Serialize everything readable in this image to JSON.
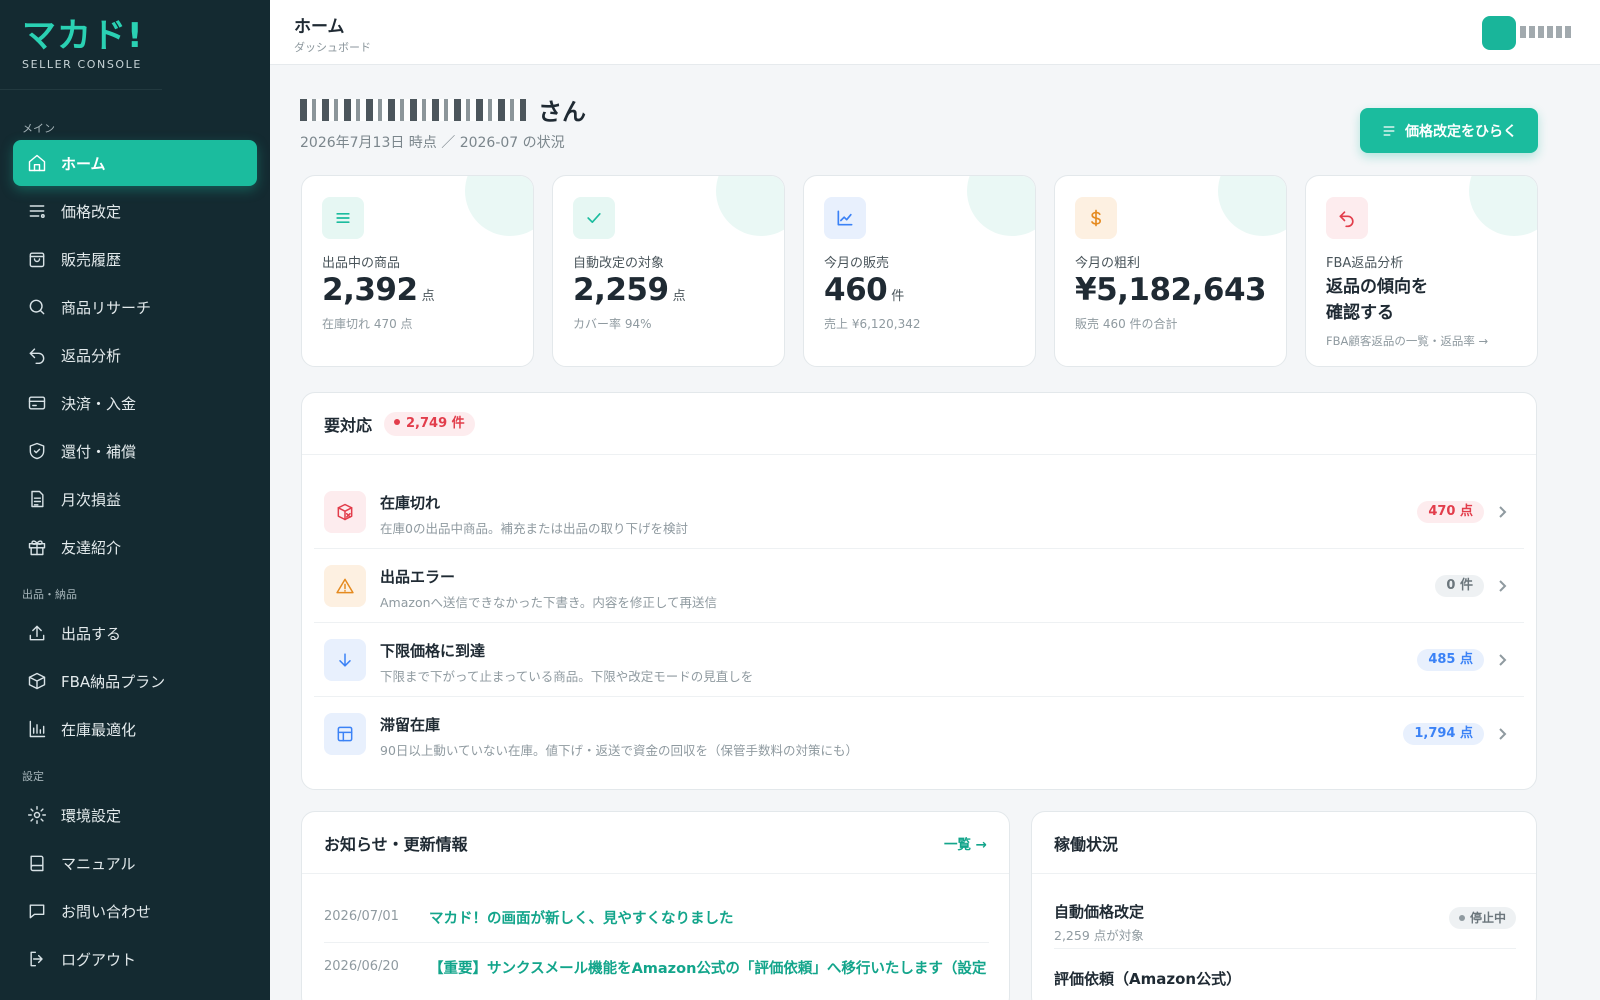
{
  "brand": {
    "logo": "マカド!",
    "sub": "SELLER CONSOLE"
  },
  "sidebar": {
    "sections": [
      {
        "label": "メイン"
      },
      {
        "label": "出品・納品"
      },
      {
        "label": "設定"
      }
    ],
    "items": [
      {
        "label": "ホーム",
        "icon": "home-icon"
      },
      {
        "label": "価格改定",
        "icon": "list-icon"
      },
      {
        "label": "販売履歴",
        "icon": "bag-icon"
      },
      {
        "label": "商品リサーチ",
        "icon": "search-icon"
      },
      {
        "label": "返品分析",
        "icon": "undo-icon"
      },
      {
        "label": "決済・入金",
        "icon": "credit-card-icon"
      },
      {
        "label": "還付・補償",
        "icon": "shield-check-icon"
      },
      {
        "label": "月次損益",
        "icon": "document-icon"
      },
      {
        "label": "友達紹介",
        "icon": "gift-icon"
      },
      {
        "label": "出品する",
        "icon": "upload-icon"
      },
      {
        "label": "FBA納品プラン",
        "icon": "box-icon"
      },
      {
        "label": "在庫最適化",
        "icon": "bar-chart-icon"
      },
      {
        "label": "環境設定",
        "icon": "gear-icon"
      },
      {
        "label": "マニュアル",
        "icon": "book-icon"
      },
      {
        "label": "お問い合わせ",
        "icon": "chat-icon"
      },
      {
        "label": "ログアウト",
        "icon": "logout-icon"
      }
    ]
  },
  "header": {
    "title": "ホーム",
    "subtitle": "ダッシュボード"
  },
  "greeting": {
    "suffix": "さん",
    "meta": "2026年7月13日 時点 ／ 2026-07 の状況"
  },
  "primary_button": {
    "label": "価格改定をひらく"
  },
  "stats": [
    {
      "label": "出品中の商品",
      "value": "2,392",
      "unit": "点",
      "sub": "在庫切れ 470 点",
      "icon": "list-icon",
      "color": "#1bbc9e",
      "bg": "#e6f7f3"
    },
    {
      "label": "自動改定の対象",
      "value": "2,259",
      "unit": "点",
      "sub": "カバー率 94%",
      "icon": "check-icon",
      "color": "#1bbc9e",
      "bg": "#e6f7f3"
    },
    {
      "label": "今月の販売",
      "value": "460",
      "unit": "件",
      "sub": "売上 ¥6,120,342",
      "icon": "line-chart-icon",
      "color": "#3b82f6",
      "bg": "#e8f0fd"
    },
    {
      "label": "今月の粗利",
      "value": "¥5,182,643",
      "unit": "",
      "sub": "販売 460 件の合計",
      "icon": "dollar-icon",
      "color": "#e58a1f",
      "bg": "#fdf0e1"
    },
    {
      "label": "FBA返品分析",
      "big1": "返品の傾向を",
      "big2": "確認する",
      "sub": "FBA顧客返品の一覧・返品率 →",
      "icon": "undo-icon",
      "color": "#e23d4b",
      "bg": "#fdecee"
    }
  ],
  "actions": {
    "title": "要対応",
    "count": "2,749 件",
    "rows": [
      {
        "title": "在庫切れ",
        "desc": "在庫0の出品中商品。補充または出品の取り下げを検討",
        "badge": "470 点",
        "icon": "box-alert-icon",
        "color": "#e23d4b",
        "bg": "#fdecee",
        "badge_color": "#e23d4b",
        "badge_bg": "#fdecee"
      },
      {
        "title": "出品エラー",
        "desc": "Amazonへ送信できなかった下書き。内容を修正して再送信",
        "badge": "0 件",
        "icon": "warning-icon",
        "color": "#e58a1f",
        "bg": "#fdf0e1",
        "badge_color": "#6b767c",
        "badge_bg": "#eef1f3"
      },
      {
        "title": "下限価格に到達",
        "desc": "下限まで下がって止まっている商品。下限や改定モードの見直しを",
        "badge": "485 点",
        "icon": "arrow-down-icon",
        "color": "#3b82f6",
        "bg": "#e8f0fd",
        "badge_color": "#3b82f6",
        "badge_bg": "#e8f0fd"
      },
      {
        "title": "滞留在庫",
        "desc": "90日以上動いていない在庫。値下げ・返送で資金の回収を（保管手数料の対策にも）",
        "badge": "1,794 点",
        "icon": "layout-icon",
        "color": "#3b82f6",
        "bg": "#e8f0fd",
        "badge_color": "#3b82f6",
        "badge_bg": "#e8f0fd"
      }
    ]
  },
  "news": {
    "title": "お知らせ・更新情報",
    "link": "一覧 →",
    "rows": [
      {
        "date": "2026/07/01",
        "title": "マカド！の画面が新しく、見やすくなりました"
      },
      {
        "date": "2026/06/20",
        "title": "【重要】サンクスメール機能をAmazon公式の「評価依頼」へ移行いたします（設定"
      }
    ]
  },
  "status": {
    "title": "稼働状況",
    "rows": [
      {
        "title": "自動価格改定",
        "sub": "2,259 点が対象",
        "pill": "停止中"
      },
      {
        "title": "評価依頼（Amazon公式）",
        "sub": "",
        "pill": ""
      }
    ]
  }
}
